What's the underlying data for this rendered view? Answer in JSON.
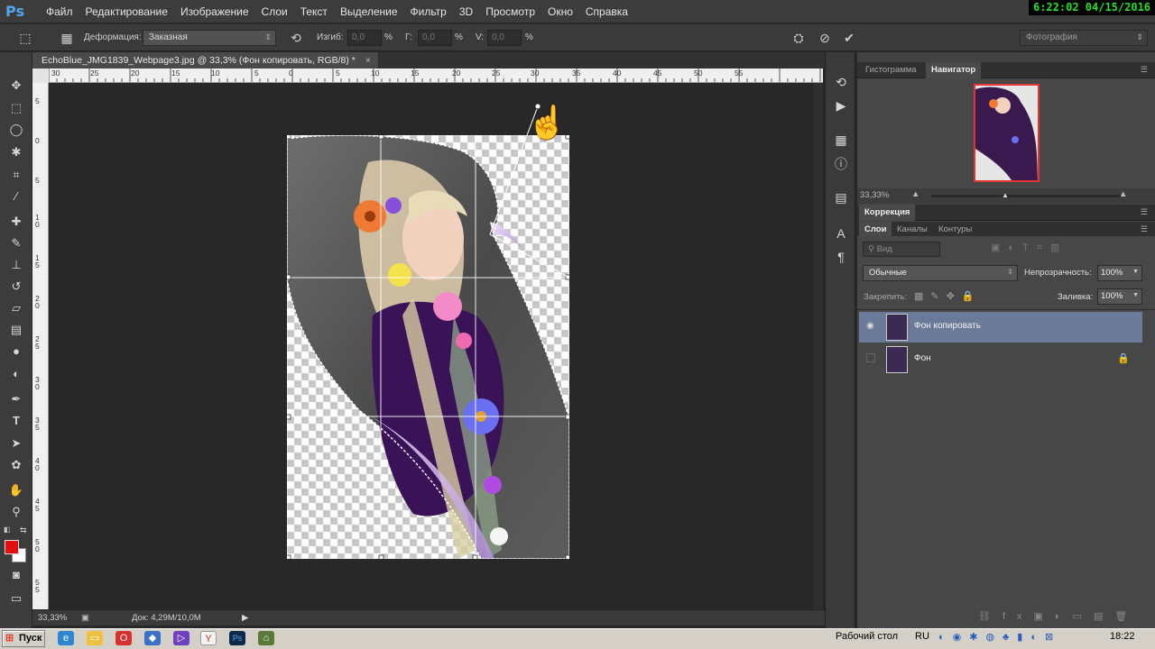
{
  "app": {
    "logo": "Ps",
    "clock": "6:22:02 04/15/2016",
    "menu": [
      "Файл",
      "Редактирование",
      "Изображение",
      "Слои",
      "Текст",
      "Выделение",
      "Фильтр",
      "3D",
      "Просмотр",
      "Окно",
      "Справка"
    ]
  },
  "options": {
    "deform_label": "Деформация:",
    "deform_value": "Заказная",
    "bend_label": "Изгиб:",
    "bend_value": "0,0",
    "bend_unit": "%",
    "h_label": "Г:",
    "h_value": "0,0",
    "h_unit": "%",
    "v_label": "V:",
    "v_value": "0,0",
    "v_unit": "%",
    "workspace": "Фотография"
  },
  "document": {
    "tab_title": "EchoBlue_JMG1839_Webpage3.jpg @ 33,3% (Фон копировать, RGB/8) *",
    "tab_close": "×",
    "zoom": "33,33%",
    "doc_info": "Док: 4,29M/10,0M",
    "hruler_labels": [
      "30",
      "25",
      "20",
      "15",
      "10",
      "5",
      "0",
      "5",
      "10",
      "15",
      "20",
      "25",
      "30",
      "35",
      "40",
      "45",
      "50",
      "55"
    ],
    "vruler_labels": [
      "5",
      "0",
      "5",
      "1 0",
      "1 5",
      "2 0",
      "2 5",
      "3 0",
      "3 5",
      "4 0",
      "4 5",
      "5 0",
      "5 5"
    ]
  },
  "navigator": {
    "tab_histogram": "Гистограмма",
    "tab_navigator": "Навигатор",
    "zoom": "33,33%"
  },
  "corrections": {
    "title": "Коррекция"
  },
  "layers": {
    "tab_layers": "Слои",
    "tab_channels": "Каналы",
    "tab_paths": "Контуры",
    "filter_placeholder": "Вид",
    "blend_mode": "Обычные",
    "opacity_label": "Непрозрачность:",
    "opacity_value": "100%",
    "lock_label": "Закрепить:",
    "fill_label": "Заливка:",
    "fill_value": "100%",
    "items": [
      {
        "name": "Фон копировать",
        "selected": true,
        "visible": true
      },
      {
        "name": "Фон",
        "selected": false,
        "visible": false,
        "locked": true
      }
    ]
  },
  "taskbar": {
    "start": "Пуск",
    "desktop": "Рабочий стол",
    "lang": "RU",
    "time": "18:22"
  },
  "colors": {
    "foreground": "#e30f0f",
    "background": "#ffffff",
    "selected_layer": "#6b7a99"
  }
}
